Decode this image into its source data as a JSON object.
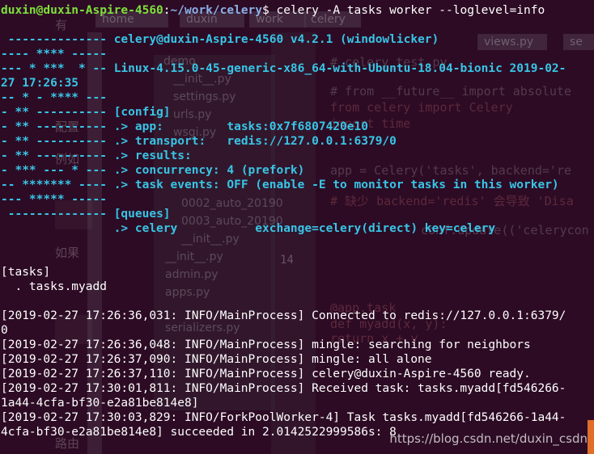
{
  "prompt": {
    "user_host": "duxin@duxin-Aspire-4560",
    "colon": ":",
    "path": "~/work/celery",
    "symbol": "$",
    "command": " celery -A tasks worker --loglevel=info"
  },
  "banner": {
    "l1_left": " -------------- ",
    "l1_right": "celery@duxin-Aspire-4560 v4.2.1 (windowlicker)",
    "l2": "---- **** -----",
    "l3_left": "--- * ***  * -- ",
    "l3_right": "Linux-4.15.0-45-generic-x86_64-with-Ubuntu-18.04-bionic 2019-02-",
    "l4": "27 17:26:35",
    "l5": "-- * - **** ---",
    "l6_left": "- ** ---------- ",
    "l6_right": "[config]",
    "l7_left": "- ** ---------- ",
    "l7_right": ".> app:         tasks:0x7f6807420e10",
    "l8_left": "- ** ---------- ",
    "l8_right": ".> transport:   redis://127.0.0.1:6379/0",
    "l9_left": "- ** ---------- ",
    "l9_right": ".> results:",
    "l10_left": "- *** --- * --- ",
    "l10_right": ".> concurrency: 4 (prefork)",
    "l11_left": "-- ******* ---- ",
    "l11_right": ".> task events: OFF (enable -E to monitor tasks in this worker)",
    "l12": "--- ***** -----",
    "l13_left": " -------------- ",
    "l13_right": "[queues]",
    "l14_right": "                .> celery           exchange=celery(direct) key=celery"
  },
  "tasks": {
    "header": "[tasks]",
    "item": "  . tasks.myadd"
  },
  "log": [
    "[2019-02-27 17:26:36,031: INFO/MainProcess] Connected to redis://127.0.0.1:6379/",
    "0",
    "[2019-02-27 17:26:36,048: INFO/MainProcess] mingle: searching for neighbors",
    "[2019-02-27 17:26:37,090: INFO/MainProcess] mingle: all alone",
    "[2019-02-27 17:26:37,110: INFO/MainProcess] celery@duxin-Aspire-4560 ready.",
    "[2019-02-27 17:30:01,811: INFO/MainProcess] Received task: tasks.myadd[fd546266-",
    "1a44-4cfa-bf30-e2a81be814e8]",
    "[2019-02-27 17:30:03,829: INFO/ForkPoolWorker-4] Task tasks.myadd[fd546266-1a44-",
    "4cfa-bf30-e2a81be814e8] succeeded in 2.0142522999586s: 8"
  ],
  "watermark": "https://blog.csdn.net/duxin_csdn",
  "ghost": {
    "tabs": [
      "home",
      "duxin",
      "work",
      "celery",
      "views.py",
      "se"
    ],
    "tree": [
      "demo",
      "__init__.py",
      "settings.py",
      "urls.py",
      "wsgi.py",
      "0002_auto_20190",
      "0003_auto_20190",
      "__init__.py",
      "__init__.py",
      "admin.py",
      "apps.py",
      "serializers.py"
    ],
    "code": [
      "# celery_test.py",
      "# from __future__ import absolute",
      "from celery import Celery",
      "import time",
      "app = Celery('tasks', backend='re",
      "# 缺少 backend='redis' 会导致 'Disa",
      "conf.update(('celerycon",
      "@app.task",
      "def myadd(x, y):",
      "    return x + y"
    ],
    "line_numbers": [
      "14"
    ],
    "left_fragments": [
      "有",
      "配置",
      "例如",
      "如果",
      "路由"
    ]
  },
  "colors": {
    "background": "#2d0b24",
    "prompt_user": "#7ee03a",
    "prompt_path": "#8ab0e8",
    "banner": "#38c5e6",
    "text": "#ffffff"
  }
}
